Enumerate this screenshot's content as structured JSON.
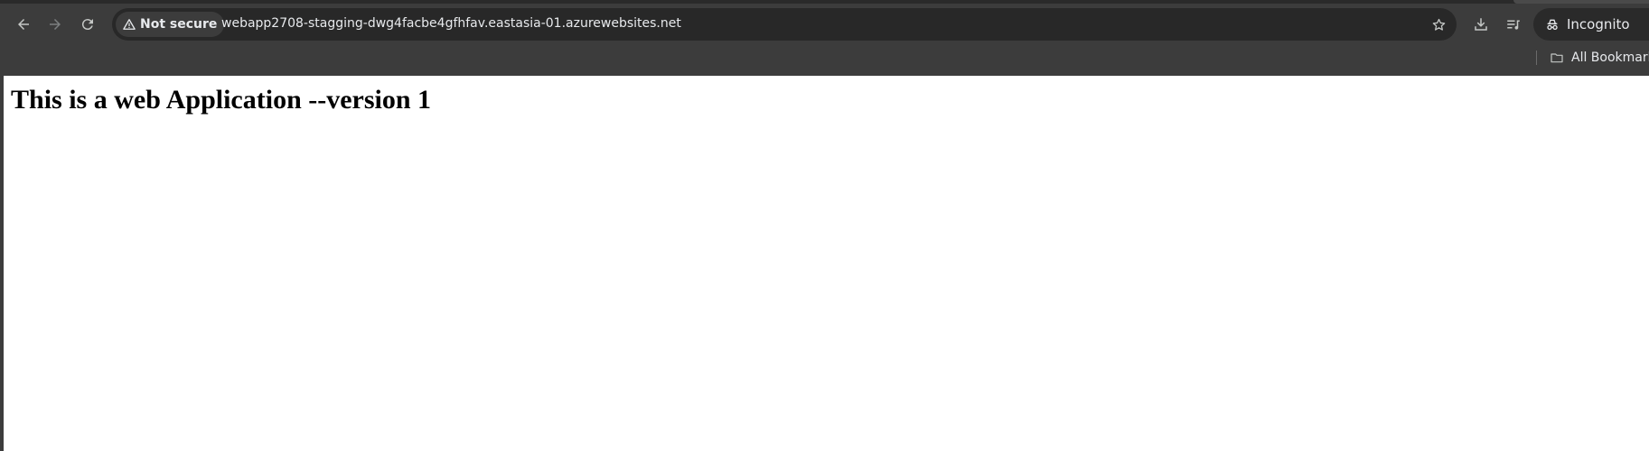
{
  "browser": {
    "security_label": "Not secure",
    "url": "webapp2708-stagging-dwg4facbe4gfhfav.eastasia-01.azurewebsites.net",
    "profile_label": "Incognito",
    "bookmarks_label": "All Bookmarks",
    "icons": {
      "back": "arrow-left-icon",
      "forward": "arrow-right-icon",
      "reload": "reload-icon",
      "warning": "warning-triangle-icon",
      "bookmark_star": "star-icon",
      "downloads": "download-icon",
      "media": "media-queue-icon",
      "incognito": "incognito-icon",
      "folder": "folder-icon"
    }
  },
  "page": {
    "heading": "This is a web Application --version 1"
  },
  "colors": {
    "chrome_bg": "#3c3c3c",
    "omnibox_bg": "#282828",
    "chrome_text": "#e8eaed",
    "page_bg": "#ffffff"
  }
}
